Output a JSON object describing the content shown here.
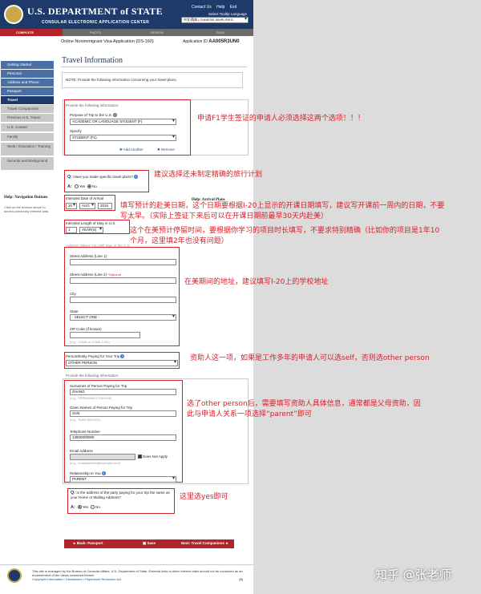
{
  "header": {
    "title": "U.S. DEPARTMENT of STATE",
    "subtitle": "CONSULAR ELECTRONIC APPLICATION CENTER",
    "links": [
      "Contact Us",
      "Help",
      "Exit"
    ],
    "language_label": "Select Tooltip Language",
    "language_value": "中文/简体 | CHINESE-SIMPLIFIED"
  },
  "steps": [
    "COMPLETE",
    "PHOTO",
    "REVIEW",
    "SIGN"
  ],
  "form": {
    "name": "Online Nonimmigrant Visa Application (DS-160)",
    "application_id_label": "Application ID",
    "application_id": "AA005R3UN0",
    "heading": "Travel Information",
    "note": "NOTE: Provide the following information concerning your travel plans."
  },
  "sidebar": {
    "items": [
      {
        "label": "Getting Started"
      },
      {
        "label": "Personal"
      },
      {
        "label": "Address and Phone"
      },
      {
        "label": "Passport"
      },
      {
        "label": "Travel"
      },
      {
        "label": "Travel Companions"
      },
      {
        "label": "Previous U.S. Travel"
      },
      {
        "label": "U.S. Contact"
      },
      {
        "label": "Family"
      },
      {
        "label": "Work / Education / Training"
      },
      {
        "label": "Security and Background"
      }
    ],
    "help_title": "Help: Navigation Buttons",
    "help_text": "Click on the buttons above to access previously entered data."
  },
  "help_arrival": "Help: Arrival Plans",
  "purpose": {
    "intro": "Provide the following information:",
    "purpose_label": "Purpose of Trip to the U.S.",
    "purpose_value": "ACADEMIC OR LANGUAGE STUDENT (F)",
    "specify_label": "Specify",
    "specify_value": "STUDENT (F1)",
    "add_link": "Add Another",
    "remove_link": "Remove"
  },
  "plans": {
    "q": "Q:",
    "question": "Have you made specific travel plans?",
    "a": "A:",
    "yes": "Yes",
    "no": "No"
  },
  "arrival": {
    "label": "Intended Date of Arrival",
    "day": "20",
    "month": "AUG",
    "year": "2016",
    "stay_label": "Intended Length of Stay in U.S.",
    "stay_value": "1",
    "stay_unit": "YEAR(S)"
  },
  "address": {
    "title": "Address Where You Will Stay in the U.S.",
    "street1": "Street Address (Line 1)",
    "street2": "Street Address (Line 2)",
    "optional": "*Optional",
    "city": "City",
    "state": "State",
    "state_value": "- SELECT ONE -",
    "zip": "ZIP Code (if known)",
    "zip_hint": "(e.g., 12345 or 12345-1234)"
  },
  "payer": {
    "label": "Person/Entity Paying for Your Trip",
    "value": "OTHER PERSON",
    "intro": "Provide the following information:",
    "surname_label": "Surnames of Person Paying for Trip",
    "surname_value": "ZHANG",
    "surname_hint": "(e.g., FERNANDEZ GARCIA)",
    "given_label": "Given Names of Person Paying for Trip",
    "given_value": "SAN",
    "given_hint": "(e.g., JUAN MIGUEL)",
    "phone_label": "Telephone Number",
    "phone_value": "13800000000",
    "email_label": "Email Address",
    "email_hint": "(e.g., emailaddress@example.com)",
    "does_not_apply": "Does Not Apply",
    "relationship_label": "Relationship to You",
    "relationship_value": "PARENT"
  },
  "same_address": {
    "q": "Q:",
    "question": "Is the address of the party paying for your trip the same as your Home or Mailing Address?",
    "a": "A:",
    "yes": "Yes",
    "no": "No"
  },
  "buttons": {
    "back": "◄ Back: Passport",
    "save": "Save",
    "next": "Next: Travel Companions ►"
  },
  "footer": {
    "text": "This site is managed by the Bureau of Consular Affairs, U.S. Department of State. External links to other Internet sites should not be construed as an endorsement of the views contained therein.",
    "links": "Copyright Information ▪ Disclaimers ▪ Paperwork Reduction Act",
    "code": "(B)"
  },
  "annotations": {
    "a1": "申请F1学生签证的申请人必须选择这两个选项！！！",
    "a2": "建议选择还未制定精确的旅行计划",
    "a3": "填写预计的赴美日期，这个日期要根据I-20上显示的开课日期填写，建议写开课前一周内的日期，不要写太早。（实际上签证下来后可以在开课日期前最早30天内赴美）",
    "a4": "这个在美预计停留时间，要根据你学习的项目时长填写，不要求特别精确（比如你的项目是1年10个月，这里填2年也没有问题）",
    "a5": "在美期间的地址，建议填写I-20上的学校地址",
    "a6": "资助人这一项，如果是工作多年的申请人可以选self，否则选other person",
    "a7": "选了other person后，需要填写资助人具体信息，通常都是父母资助，因此与申请人关系一项选择“parent”即可",
    "a8": "这里选yes即可"
  },
  "watermark": "知乎 @张老师",
  "colors": {
    "navy": "#1d3a6b",
    "red": "#b3242a",
    "annotation": "#d8202a"
  }
}
